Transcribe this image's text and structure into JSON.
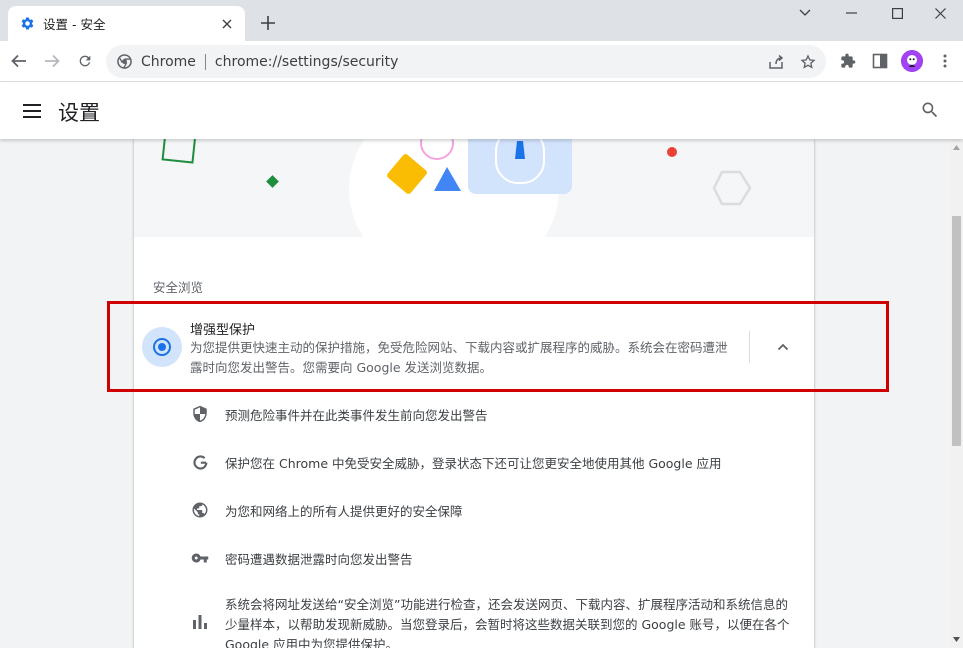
{
  "tab": {
    "title": "设置 - 安全",
    "favicon": "settings-gear-icon",
    "accent_color": "#1a73e8"
  },
  "toolbar": {
    "site_name": "Chrome",
    "url": "chrome://settings/security"
  },
  "header": {
    "title": "设置"
  },
  "section": {
    "label": "安全浏览"
  },
  "enhanced": {
    "title": "增强型保护",
    "description": "为您提供更快速主动的保护措施，免受危险网站、下载内容或扩展程序的威胁。系统会在密码遭泄露时向您发出警告。您需要向 Google 发送浏览数据。",
    "selected": true
  },
  "features": [
    {
      "icon": "shield-icon",
      "text": "预测危险事件并在此类事件发生前向您发出警告"
    },
    {
      "icon": "google-g-icon",
      "text": "保护您在 Chrome 中免受安全威胁，登录状态下还可让您更安全地使用其他 Google 应用"
    },
    {
      "icon": "globe-icon",
      "text": "为您和网络上的所有人提供更好的安全保障"
    },
    {
      "icon": "key-icon",
      "text": "密码遭遇数据泄露时向您发出警告"
    },
    {
      "icon": "bar-chart-icon",
      "text": "系统会将网址发送给“安全浏览”功能进行检查，还会发送网页、下载内容、扩展程序活动和系统信息的少量样本，以帮助发现新威胁。当您登录后，会暂时将这些数据关联到您的 Google 账号，以便在各个 Google 应用中为您提供保护。"
    }
  ],
  "highlight_color": "#d00000"
}
